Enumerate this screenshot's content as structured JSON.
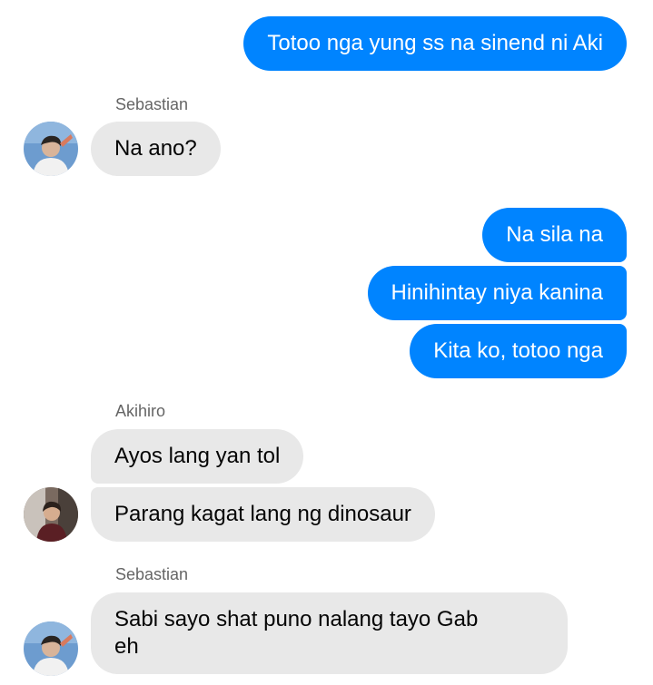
{
  "colors": {
    "outgoing_bubble": "#0084ff",
    "incoming_bubble": "#e8e8e8",
    "sender_name": "#656565"
  },
  "conversation": {
    "msg1": {
      "direction": "outgoing",
      "text": "Totoo nga yung ss na sinend ni Aki"
    },
    "group1": {
      "sender": "Sebastian",
      "avatar": "sebastian-avatar",
      "msg1": {
        "direction": "incoming",
        "text": "Na ano?"
      }
    },
    "msg2": {
      "direction": "outgoing",
      "text": "Na sila na"
    },
    "msg3": {
      "direction": "outgoing",
      "text": "Hinihintay niya kanina"
    },
    "msg4": {
      "direction": "outgoing",
      "text": "Kita ko, totoo nga"
    },
    "group2": {
      "sender": "Akihiro",
      "avatar": "akihiro-avatar",
      "msg1": {
        "direction": "incoming",
        "text": "Ayos lang yan tol"
      },
      "msg2": {
        "direction": "incoming",
        "text": "Parang kagat lang ng dinosaur"
      }
    },
    "group3": {
      "sender": "Sebastian",
      "avatar": "sebastian-avatar",
      "msg1": {
        "direction": "incoming",
        "line1": "Sabi sayo shat puno nalang tayo Gab",
        "line2": "eh"
      }
    }
  }
}
